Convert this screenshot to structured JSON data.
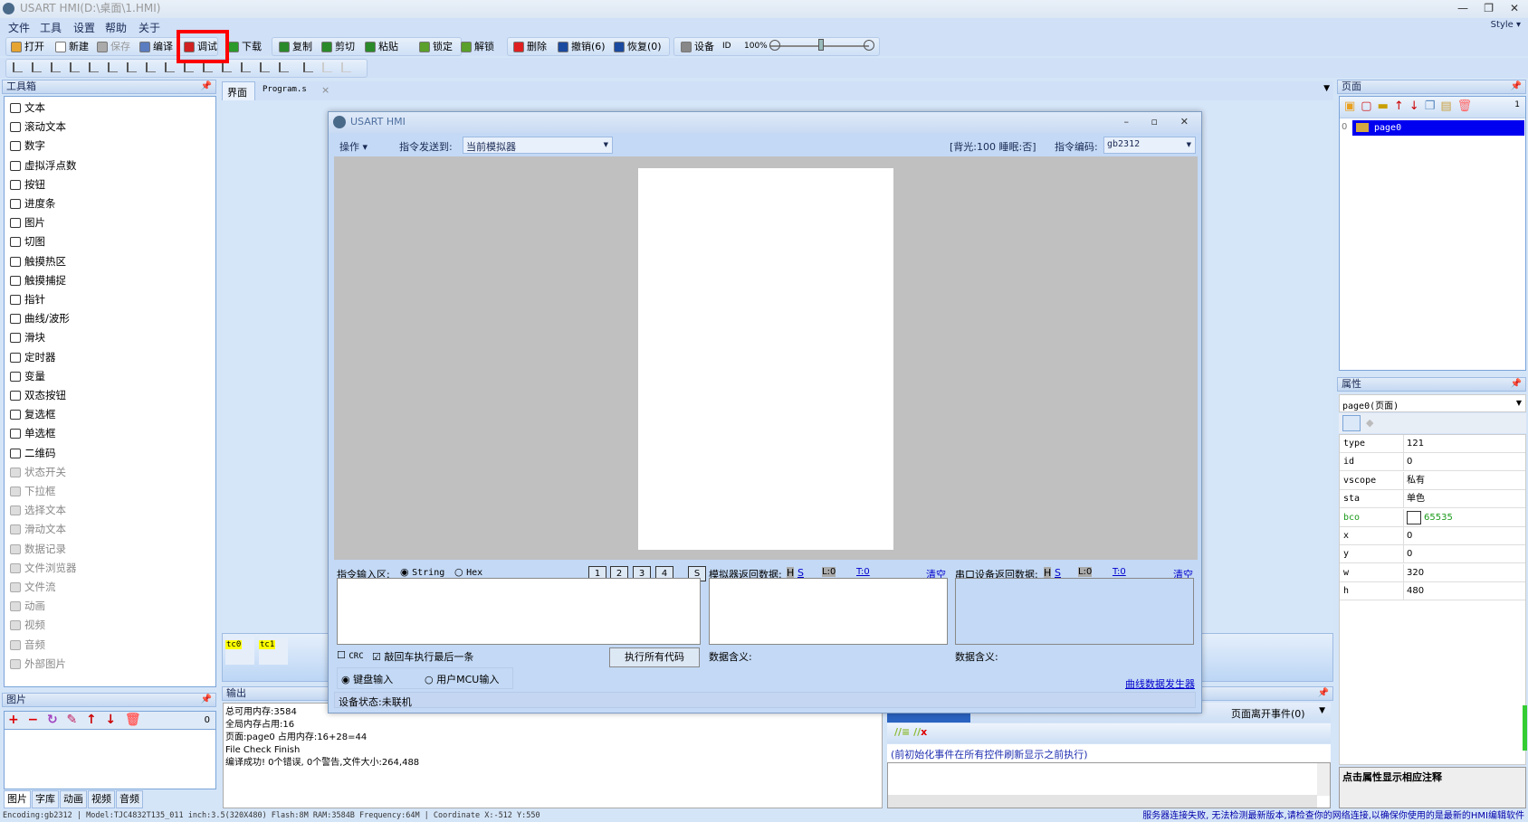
{
  "window": {
    "title": "USART  HMI(D:\\桌面\\1.HMI)",
    "style_label": "Style ▾"
  },
  "menu": [
    "文件",
    "工具",
    "设置",
    "帮助",
    "关于"
  ],
  "toolbar1": [
    {
      "label": "打开",
      "icon": "open-folder-icon",
      "color": "#e6a530"
    },
    {
      "label": "新建",
      "icon": "new-file-icon",
      "color": "#fff"
    },
    {
      "label": "保存",
      "icon": "save-icon",
      "color": "#aaa",
      "disabled": true
    },
    {
      "label": "编译",
      "icon": "compile-icon",
      "color": "#5a7cc0"
    },
    {
      "label": "调试",
      "icon": "debug-icon",
      "color": "#d02020"
    },
    {
      "label": "下载",
      "icon": "download-icon",
      "color": "#2a9a2a"
    },
    {
      "label": "复制",
      "icon": "copy-icon",
      "color": "#2a8a2a"
    },
    {
      "label": "剪切",
      "icon": "cut-icon",
      "color": "#2a8a2a"
    },
    {
      "label": "粘贴",
      "icon": "paste-icon",
      "color": "#2a8a2a"
    },
    {
      "label": "锁定",
      "icon": "lock-icon",
      "color": "#5aa02a"
    },
    {
      "label": "解锁",
      "icon": "unlock-icon",
      "color": "#5aa02a"
    },
    {
      "label": "删除",
      "icon": "delete-icon",
      "color": "#e02020"
    },
    {
      "label": "撤销(6)",
      "icon": "undo-icon",
      "color": "#1a4aa0"
    },
    {
      "label": "恢复(0)",
      "icon": "redo-icon",
      "color": "#1a4aa0"
    },
    {
      "label": "设备",
      "icon": "gear-icon",
      "color": "#888"
    },
    {
      "label": "ID",
      "icon": "",
      "color": ""
    },
    {
      "label": "100%",
      "icon": "",
      "color": ""
    }
  ],
  "toolbar2_icons": [
    "move-up-icon",
    "move-down-icon",
    "align-left-icon",
    "align-right-icon",
    "align-top-icon",
    "align-bottom-icon",
    "center-h-icon",
    "center-v-icon",
    "grid-icon",
    "space-h-icon",
    "space-h2-icon",
    "space-h3-icon",
    "space-v-icon",
    "space-v2-icon",
    "space-v3-icon",
    "c-icon",
    "comment-icon",
    "uncomment-icon"
  ],
  "toolbox": {
    "title": "工具箱",
    "items": [
      {
        "label": "文本",
        "on": true
      },
      {
        "label": "滚动文本",
        "on": true
      },
      {
        "label": "数字",
        "on": true
      },
      {
        "label": "虚拟浮点数",
        "on": true
      },
      {
        "label": "按钮",
        "on": true
      },
      {
        "label": "进度条",
        "on": true
      },
      {
        "label": "图片",
        "on": true
      },
      {
        "label": "切图",
        "on": true
      },
      {
        "label": "触摸热区",
        "on": true
      },
      {
        "label": "触摸捕捉",
        "on": true
      },
      {
        "label": "指针",
        "on": true
      },
      {
        "label": "曲线/波形",
        "on": true
      },
      {
        "label": "滑块",
        "on": true
      },
      {
        "label": "定时器",
        "on": true
      },
      {
        "label": "变量",
        "on": true
      },
      {
        "label": "双态按钮",
        "on": true
      },
      {
        "label": "复选框",
        "on": true
      },
      {
        "label": "单选框",
        "on": true
      },
      {
        "label": "二维码",
        "on": true
      },
      {
        "label": "状态开关",
        "on": false
      },
      {
        "label": "下拉框",
        "on": false
      },
      {
        "label": "选择文本",
        "on": false
      },
      {
        "label": "滑动文本",
        "on": false
      },
      {
        "label": "数据记录",
        "on": false
      },
      {
        "label": "文件浏览器",
        "on": false
      },
      {
        "label": "文件流",
        "on": false
      },
      {
        "label": "动画",
        "on": false
      },
      {
        "label": "视频",
        "on": false
      },
      {
        "label": "音频",
        "on": false
      },
      {
        "label": "外部图片",
        "on": false
      }
    ]
  },
  "pictures": {
    "title": "图片",
    "count": "0",
    "tabs": [
      "图片",
      "字库",
      "动画",
      "视频",
      "音频"
    ]
  },
  "editor": {
    "tabs": [
      "界面",
      "Program.s"
    ],
    "close": "×",
    "timers": [
      "tc0",
      "tc1"
    ]
  },
  "output": {
    "title": "输出",
    "lines": [
      "总可用内存:3584",
      "全局内存占用:16",
      "页面:page0 占用内存:16+28=44",
      "File Check Finish",
      "编译成功! 0个错误, 0个警告,文件大小:264,488"
    ]
  },
  "events": {
    "active_tab": "页面离开事件(0)",
    "note": "(前初始化事件在所有控件刷新显示之前执行)"
  },
  "pages": {
    "title": "页面",
    "count": "1",
    "items": [
      {
        "index": "0",
        "name": "page0"
      }
    ]
  },
  "properties": {
    "title": "属性",
    "selected": "page0(页面)",
    "rows": [
      {
        "k": "type",
        "v": "121"
      },
      {
        "k": "id",
        "v": "0"
      },
      {
        "k": "vscope",
        "v": "私有"
      },
      {
        "k": "sta",
        "v": "单色"
      },
      {
        "k": "bco",
        "v": "65535",
        "color": "#1a9a1a"
      },
      {
        "k": "x",
        "v": "0"
      },
      {
        "k": "y",
        "v": "0"
      },
      {
        "k": "w",
        "v": "320"
      },
      {
        "k": "h",
        "v": "480"
      }
    ],
    "hint": "点击属性显示相应注释"
  },
  "debug": {
    "title": "USART HMI",
    "ops": "操作 ▾",
    "send_to_label": "指令发送到:",
    "send_to": "当前模拟器",
    "status_info": "[背光:100  睡眠:否]",
    "encoding_label": "指令编码:",
    "encoding": "gb2312",
    "cmd_label": "指令输入区:",
    "string": "String",
    "hex": "Hex",
    "num_buttons": [
      "1",
      "2",
      "3",
      "4",
      "S"
    ],
    "sim_label": "模拟器返回数据:",
    "serial_label": "串口设备返回数据:",
    "H": "H",
    "S": "S",
    "L": "L:0",
    "T": "T:0",
    "clear": "清空",
    "crc": "CRC",
    "enter_exec": "敲回车执行最后一条",
    "exec_all": "执行所有代码",
    "data_meaning": "数据含义:",
    "kbd": "键盘输入",
    "mcu": "用户MCU输入",
    "curve_link": "曲线数据发生器",
    "device_status": "设备状态:未联机"
  },
  "statusbar": {
    "left": "Encoding:gb2312  | Model:TJC4832T135_011  inch:3.5(320X480) Flash:8M RAM:3584B Frequency:64M   |   Coordinate X:-512  Y:550",
    "right": "服务器连接失败, 无法检测最新版本,请检查你的网络连接,以确保你使用的是最新的HMI编辑软件"
  }
}
